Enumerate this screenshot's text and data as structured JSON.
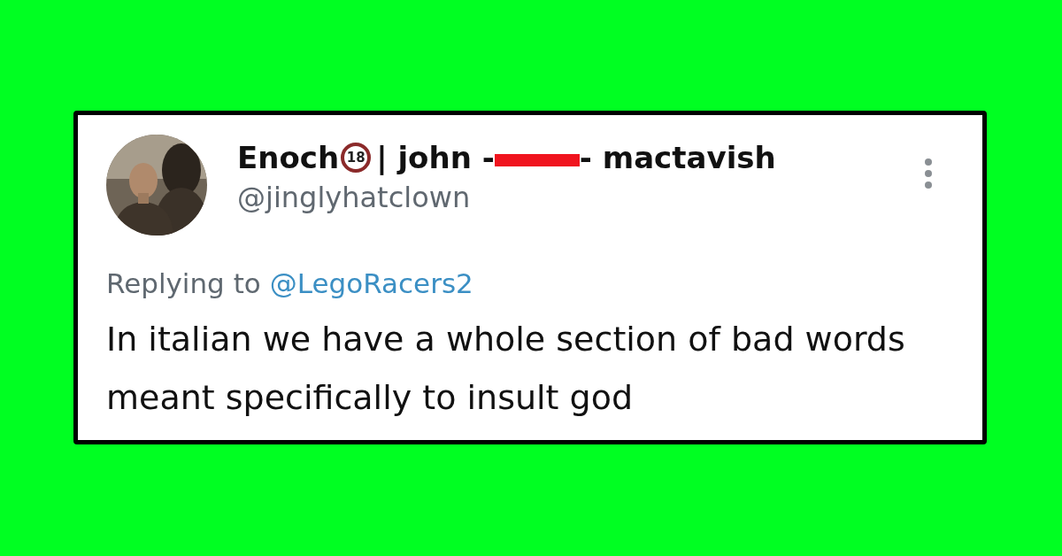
{
  "tweet": {
    "display_name": {
      "first": "Enoch",
      "badge": "18",
      "middle": "| john -",
      "redacted": true,
      "last": "- mactavish"
    },
    "handle": "@jinglyhatclown",
    "reply": {
      "prefix": "Replying to",
      "mention": "@LegoRacers2"
    },
    "text": "In italian we have a whole section of bad words meant specifically to insult god"
  }
}
